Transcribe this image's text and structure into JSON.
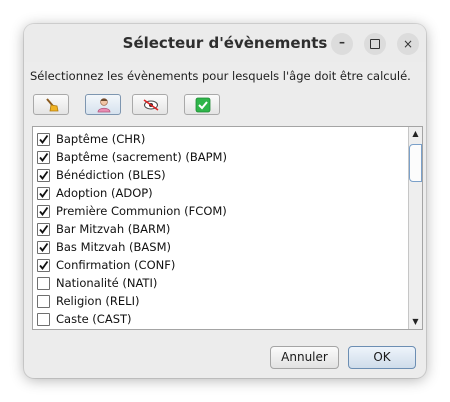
{
  "window": {
    "title": "Sélecteur d'évènements",
    "minimize_label": "–",
    "close_label": "×"
  },
  "prompt": "Sélectionnez les évènements pour lesquels l'âge doit être calculé.",
  "toolbar": {
    "buttons": [
      {
        "icon": "broom-icon"
      },
      {
        "icon": "person-icon"
      },
      {
        "icon": "no-eye-icon"
      },
      {
        "icon": "checkmark-icon"
      }
    ]
  },
  "events": [
    {
      "label": "Baptême (CHR)",
      "checked": true
    },
    {
      "label": "Baptême (sacrement) (BAPM)",
      "checked": true
    },
    {
      "label": "Bénédiction (BLES)",
      "checked": true
    },
    {
      "label": "Adoption (ADOP)",
      "checked": true
    },
    {
      "label": "Première Communion (FCOM)",
      "checked": true
    },
    {
      "label": "Bar Mitzvah (BARM)",
      "checked": true
    },
    {
      "label": "Bas Mitzvah (BASM)",
      "checked": true
    },
    {
      "label": "Confirmation (CONF)",
      "checked": true
    },
    {
      "label": "Nationalité (NATI)",
      "checked": false
    },
    {
      "label": "Religion (RELI)",
      "checked": false
    },
    {
      "label": "Caste (CAST)",
      "checked": false
    }
  ],
  "scrollbar": {
    "up_arrow": "▲",
    "down_arrow": "▼"
  },
  "footer": {
    "cancel_label": "Annuler",
    "ok_label": "OK"
  },
  "colors": {
    "accent": "#5b87b8",
    "window_bg": "#ececec",
    "list_bg": "#ffffff"
  }
}
